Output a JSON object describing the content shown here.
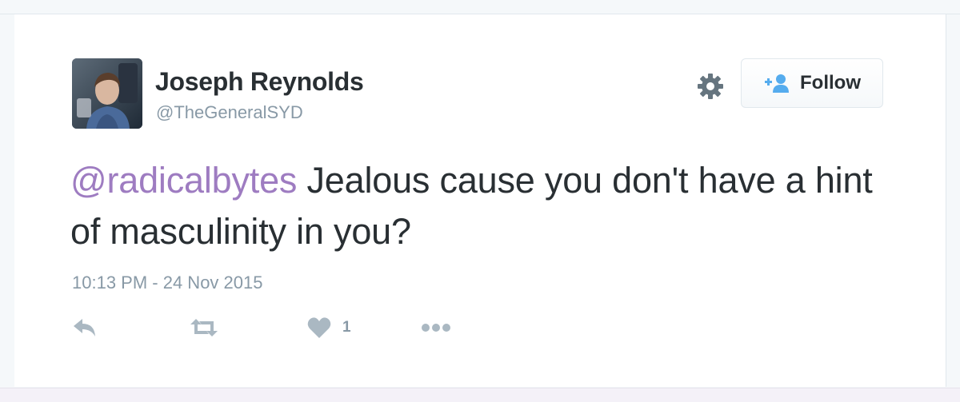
{
  "tweet": {
    "author": {
      "display_name": "Joseph Reynolds",
      "handle": "@TheGeneralSYD",
      "avatar_icon": "profile-photo"
    },
    "follow_button": {
      "label": "Follow",
      "icon": "add-user-icon"
    },
    "settings_icon": "gear-icon",
    "text": {
      "mention": "@radicalbytes",
      "body": " Jealous cause you don't have a hint of masculinity in you?"
    },
    "timestamp": "10:13 PM - 24 Nov 2015",
    "actions": {
      "reply_icon": "reply-icon",
      "retweet_icon": "retweet-icon",
      "like_icon": "heart-icon",
      "like_count": "1",
      "more_icon": "more-dots-icon"
    }
  },
  "colors": {
    "mention": "#9e7cc1",
    "text": "#292f33",
    "muted": "#8899a6",
    "follow_icon": "#55acee",
    "action_icon": "#aab8c2"
  }
}
